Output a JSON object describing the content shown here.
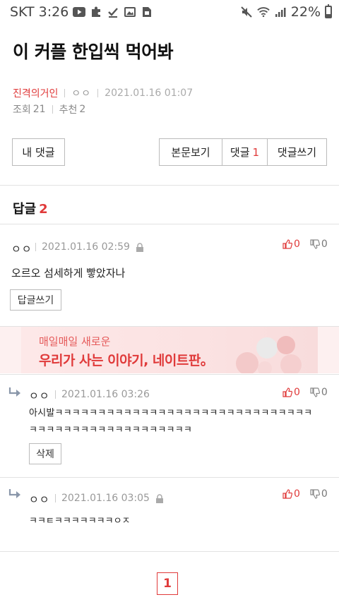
{
  "status_bar": {
    "carrier": "SKT",
    "time": "3:26",
    "battery": "22%"
  },
  "post": {
    "title": "이 커플 한입씩 먹어봐",
    "author": "진격의거인",
    "user": "ㅇㅇ",
    "datetime": "2021.01.16 01:07",
    "views_label": "조회",
    "views": "21",
    "recommend_label": "추천",
    "recommend": "2"
  },
  "toolbar": {
    "my_comments": "내 댓글",
    "view_body": "본문보기",
    "comments_label": "댓글",
    "comments_count": "1",
    "write_comment": "댓글쓰기"
  },
  "replies": {
    "label": "답글",
    "count": "2"
  },
  "comments": [
    {
      "user": "ㅇㅇ",
      "date": "2021.01.16 02:59",
      "text": "오르오 섬세하게 빻았자나",
      "likes": "0",
      "dislikes": "0",
      "action": "답글쓰기"
    },
    {
      "user": "ㅇㅇ",
      "date": "2021.01.16 03:26",
      "text_line1": "아시발ㅋㅋㅋㅋㅋㅋㅋㅋㅋㅋㅋㅋㅋㅋㅋㅋㅋㅋㅋㅋㅋㅋㅋㅋㅋㅋㅋㅋㅋㅋ",
      "text_line2": "ㅋㅋㅋㅋㅋㅋㅋㅋㅋㅋㅋㅋㅋㅋㅋㅋㅋㅋㅋ",
      "likes": "0",
      "dislikes": "0",
      "action": "삭제"
    },
    {
      "user": "ㅇㅇ",
      "date": "2021.01.16 03:05",
      "text": "ㅋㅋㅌㅋㅋㅋㅋㅋㅋㅋㅇㅈ",
      "likes": "0",
      "dislikes": "0"
    }
  ],
  "ad": {
    "line1": "매일매일 새로운",
    "line2": "우리가 사는 이야기, 네이트판。"
  },
  "pagination": {
    "current_page": "1"
  },
  "colors": {
    "accent": "#e03a3a",
    "divider": "#e2e2e2"
  }
}
